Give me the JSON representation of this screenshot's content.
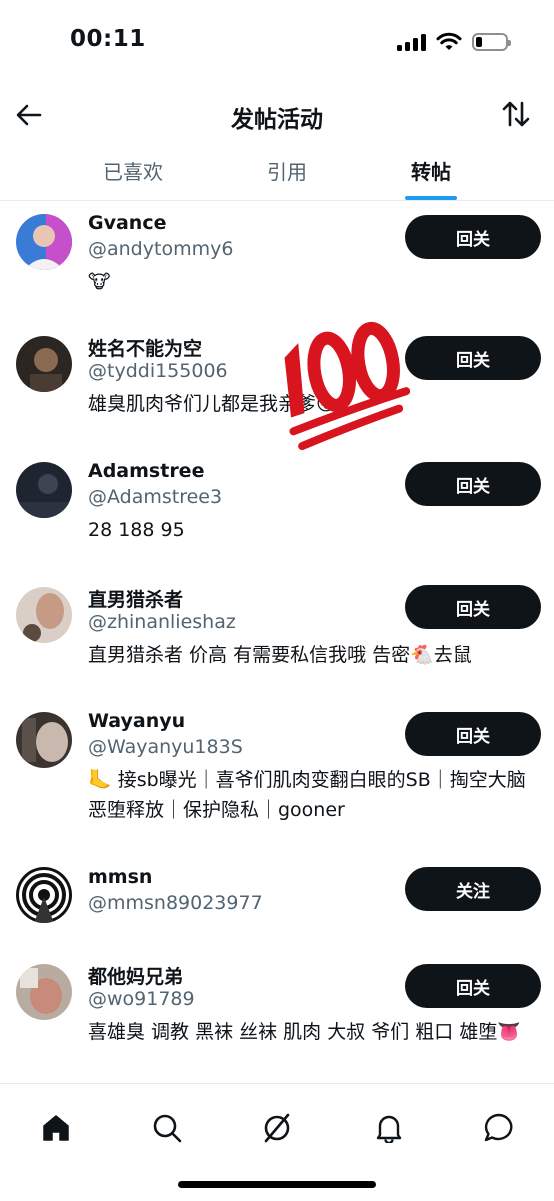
{
  "status_bar": {
    "time": "00:11"
  },
  "header": {
    "title": "发帖活动"
  },
  "tabs": [
    {
      "label": "已喜欢",
      "active": false
    },
    {
      "label": "引用",
      "active": false
    },
    {
      "label": "转帖",
      "active": true
    }
  ],
  "accent_color": "#1d9bf0",
  "users": [
    {
      "name": "Gvance",
      "handle": "@andytommy6",
      "bio": "🐮",
      "button": "回关"
    },
    {
      "name": "姓名不能为空",
      "handle": "@tyddi155006",
      "bio": "雄臭肌肉爷们儿都是我亲爹😜",
      "button": "回关"
    },
    {
      "name": "Adamstree",
      "handle": "@Adamstree3",
      "bio": "28 188 95",
      "button": "回关"
    },
    {
      "name": "直男猎杀者",
      "handle": "@zhinanlieshaz",
      "bio": "直男猎杀者 价高 有需要私信我哦 告密🐔去鼠",
      "button": "回关"
    },
    {
      "name": "Wayanyu",
      "handle": "@Wayanyu183S",
      "bio": "🦶 接sb曝光｜喜爷们肌肉变翻白眼的SB｜掏空大脑恶堕释放｜保护隐私｜gooner",
      "button": "回关"
    },
    {
      "name": "mmsn",
      "handle": "@mmsn89023977",
      "bio": "",
      "button": "关注"
    },
    {
      "name": "都他妈兄弟",
      "handle": "@wo91789",
      "bio": "喜雄臭 调教 黑袜 丝袜 肌肉 大叔 爷们 粗口 雄堕👅",
      "button": "回关"
    }
  ],
  "sticker": {
    "icon": "hundred-points-icon"
  },
  "bottom_nav": [
    {
      "icon": "home-icon"
    },
    {
      "icon": "search-icon"
    },
    {
      "icon": "grok-icon"
    },
    {
      "icon": "bell-icon"
    },
    {
      "icon": "messages-icon"
    }
  ]
}
